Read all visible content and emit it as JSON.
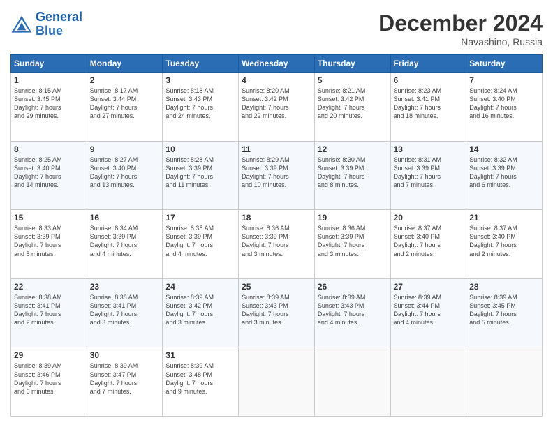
{
  "header": {
    "logo_line1": "General",
    "logo_line2": "Blue",
    "month_title": "December 2024",
    "location": "Navashino, Russia"
  },
  "weekdays": [
    "Sunday",
    "Monday",
    "Tuesday",
    "Wednesday",
    "Thursday",
    "Friday",
    "Saturday"
  ],
  "weeks": [
    [
      {
        "day": "1",
        "text": "Sunrise: 8:15 AM\nSunset: 3:45 PM\nDaylight: 7 hours\nand 29 minutes."
      },
      {
        "day": "2",
        "text": "Sunrise: 8:17 AM\nSunset: 3:44 PM\nDaylight: 7 hours\nand 27 minutes."
      },
      {
        "day": "3",
        "text": "Sunrise: 8:18 AM\nSunset: 3:43 PM\nDaylight: 7 hours\nand 24 minutes."
      },
      {
        "day": "4",
        "text": "Sunrise: 8:20 AM\nSunset: 3:42 PM\nDaylight: 7 hours\nand 22 minutes."
      },
      {
        "day": "5",
        "text": "Sunrise: 8:21 AM\nSunset: 3:42 PM\nDaylight: 7 hours\nand 20 minutes."
      },
      {
        "day": "6",
        "text": "Sunrise: 8:23 AM\nSunset: 3:41 PM\nDaylight: 7 hours\nand 18 minutes."
      },
      {
        "day": "7",
        "text": "Sunrise: 8:24 AM\nSunset: 3:40 PM\nDaylight: 7 hours\nand 16 minutes."
      }
    ],
    [
      {
        "day": "8",
        "text": "Sunrise: 8:25 AM\nSunset: 3:40 PM\nDaylight: 7 hours\nand 14 minutes."
      },
      {
        "day": "9",
        "text": "Sunrise: 8:27 AM\nSunset: 3:40 PM\nDaylight: 7 hours\nand 13 minutes."
      },
      {
        "day": "10",
        "text": "Sunrise: 8:28 AM\nSunset: 3:39 PM\nDaylight: 7 hours\nand 11 minutes."
      },
      {
        "day": "11",
        "text": "Sunrise: 8:29 AM\nSunset: 3:39 PM\nDaylight: 7 hours\nand 10 minutes."
      },
      {
        "day": "12",
        "text": "Sunrise: 8:30 AM\nSunset: 3:39 PM\nDaylight: 7 hours\nand 8 minutes."
      },
      {
        "day": "13",
        "text": "Sunrise: 8:31 AM\nSunset: 3:39 PM\nDaylight: 7 hours\nand 7 minutes."
      },
      {
        "day": "14",
        "text": "Sunrise: 8:32 AM\nSunset: 3:39 PM\nDaylight: 7 hours\nand 6 minutes."
      }
    ],
    [
      {
        "day": "15",
        "text": "Sunrise: 8:33 AM\nSunset: 3:39 PM\nDaylight: 7 hours\nand 5 minutes."
      },
      {
        "day": "16",
        "text": "Sunrise: 8:34 AM\nSunset: 3:39 PM\nDaylight: 7 hours\nand 4 minutes."
      },
      {
        "day": "17",
        "text": "Sunrise: 8:35 AM\nSunset: 3:39 PM\nDaylight: 7 hours\nand 4 minutes."
      },
      {
        "day": "18",
        "text": "Sunrise: 8:36 AM\nSunset: 3:39 PM\nDaylight: 7 hours\nand 3 minutes."
      },
      {
        "day": "19",
        "text": "Sunrise: 8:36 AM\nSunset: 3:39 PM\nDaylight: 7 hours\nand 3 minutes."
      },
      {
        "day": "20",
        "text": "Sunrise: 8:37 AM\nSunset: 3:40 PM\nDaylight: 7 hours\nand 2 minutes."
      },
      {
        "day": "21",
        "text": "Sunrise: 8:37 AM\nSunset: 3:40 PM\nDaylight: 7 hours\nand 2 minutes."
      }
    ],
    [
      {
        "day": "22",
        "text": "Sunrise: 8:38 AM\nSunset: 3:41 PM\nDaylight: 7 hours\nand 2 minutes."
      },
      {
        "day": "23",
        "text": "Sunrise: 8:38 AM\nSunset: 3:41 PM\nDaylight: 7 hours\nand 3 minutes."
      },
      {
        "day": "24",
        "text": "Sunrise: 8:39 AM\nSunset: 3:42 PM\nDaylight: 7 hours\nand 3 minutes."
      },
      {
        "day": "25",
        "text": "Sunrise: 8:39 AM\nSunset: 3:43 PM\nDaylight: 7 hours\nand 3 minutes."
      },
      {
        "day": "26",
        "text": "Sunrise: 8:39 AM\nSunset: 3:43 PM\nDaylight: 7 hours\nand 4 minutes."
      },
      {
        "day": "27",
        "text": "Sunrise: 8:39 AM\nSunset: 3:44 PM\nDaylight: 7 hours\nand 4 minutes."
      },
      {
        "day": "28",
        "text": "Sunrise: 8:39 AM\nSunset: 3:45 PM\nDaylight: 7 hours\nand 5 minutes."
      }
    ],
    [
      {
        "day": "29",
        "text": "Sunrise: 8:39 AM\nSunset: 3:46 PM\nDaylight: 7 hours\nand 6 minutes."
      },
      {
        "day": "30",
        "text": "Sunrise: 8:39 AM\nSunset: 3:47 PM\nDaylight: 7 hours\nand 7 minutes."
      },
      {
        "day": "31",
        "text": "Sunrise: 8:39 AM\nSunset: 3:48 PM\nDaylight: 7 hours\nand 9 minutes."
      },
      {
        "day": "",
        "text": ""
      },
      {
        "day": "",
        "text": ""
      },
      {
        "day": "",
        "text": ""
      },
      {
        "day": "",
        "text": ""
      }
    ]
  ]
}
